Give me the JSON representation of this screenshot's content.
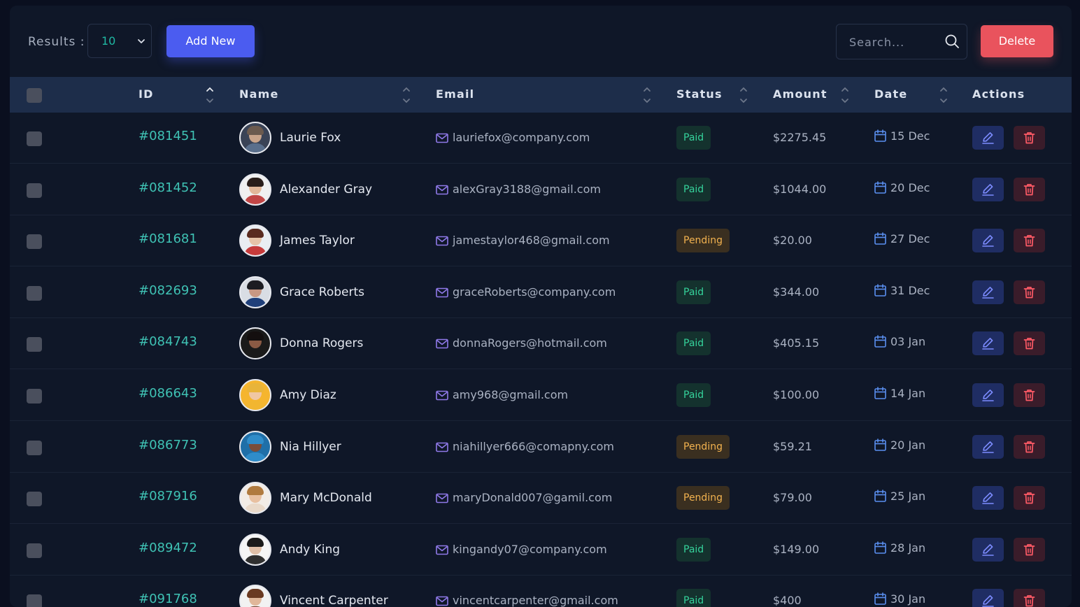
{
  "toolbar": {
    "results_label": "Results :",
    "results_value": "10",
    "add_label": "Add New",
    "search_placeholder": "Search...",
    "delete_label": "Delete"
  },
  "columns": {
    "id": "ID",
    "name": "Name",
    "email": "Email",
    "status": "Status",
    "amount": "Amount",
    "date": "Date",
    "actions": "Actions"
  },
  "rows": [
    {
      "id": "#081451",
      "name": "Laurie Fox",
      "email": "lauriefox@company.com",
      "status": "Paid",
      "amount": "$2275.45",
      "date": "15 Dec"
    },
    {
      "id": "#081452",
      "name": "Alexander Gray",
      "email": "alexGray3188@gmail.com",
      "status": "Paid",
      "amount": "$1044.00",
      "date": "20 Dec"
    },
    {
      "id": "#081681",
      "name": "James Taylor",
      "email": "jamestaylor468@gmail.com",
      "status": "Pending",
      "amount": "$20.00",
      "date": "27 Dec"
    },
    {
      "id": "#082693",
      "name": "Grace Roberts",
      "email": "graceRoberts@company.com",
      "status": "Paid",
      "amount": "$344.00",
      "date": "31 Dec"
    },
    {
      "id": "#084743",
      "name": "Donna Rogers",
      "email": "donnaRogers@hotmail.com",
      "status": "Paid",
      "amount": "$405.15",
      "date": "03 Jan"
    },
    {
      "id": "#086643",
      "name": "Amy Diaz",
      "email": "amy968@gmail.com",
      "status": "Paid",
      "amount": "$100.00",
      "date": "14 Jan"
    },
    {
      "id": "#086773",
      "name": "Nia Hillyer",
      "email": "niahillyer666@comapny.com",
      "status": "Pending",
      "amount": "$59.21",
      "date": "20 Jan"
    },
    {
      "id": "#087916",
      "name": "Mary McDonald",
      "email": "maryDonald007@gamil.com",
      "status": "Pending",
      "amount": "$79.00",
      "date": "25 Jan"
    },
    {
      "id": "#089472",
      "name": "Andy King",
      "email": "kingandy07@company.com",
      "status": "Paid",
      "amount": "$149.00",
      "date": "28 Jan"
    },
    {
      "id": "#091768",
      "name": "Vincent Carpenter",
      "email": "vincentcarpenter@gmail.com",
      "status": "Paid",
      "amount": "$400",
      "date": "30 Jan"
    }
  ],
  "avatars": [
    {
      "skin": "#c9a48a",
      "hair": "#6b5a4e",
      "shirt": "#5a6f8c",
      "bg": "#3a4356"
    },
    {
      "skin": "#e2b89a",
      "hair": "#2a1e1a",
      "shirt": "#c24646",
      "bg": "#f0f0f0"
    },
    {
      "skin": "#e6c3a8",
      "hair": "#5a2b20",
      "shirt": "#c73b3b",
      "bg": "#e9edf2"
    },
    {
      "skin": "#c99883",
      "hair": "#1c1c22",
      "shirt": "#1f3f7a",
      "bg": "#d9dde4"
    },
    {
      "skin": "#8a5a44",
      "hair": "#140f0f",
      "shirt": "#1a1a1a",
      "bg": "#1a1a1a"
    },
    {
      "skin": "#f0c7a4",
      "hair": "#e8b43a",
      "shirt": "#f2b630",
      "bg": "#f5b52e"
    },
    {
      "skin": "#7a4d3a",
      "hair": "#2f8cc9",
      "shirt": "#2f8cc9",
      "bg": "#1f6fa8"
    },
    {
      "skin": "#e8c0a0",
      "hair": "#b07a3e",
      "shirt": "#e9d9c9",
      "bg": "#f2ece6"
    },
    {
      "skin": "#e0c0a8",
      "hair": "#1a1a1a",
      "shirt": "#303030",
      "bg": "#f5f5f5"
    },
    {
      "skin": "#e0b79a",
      "hair": "#6a3a22",
      "shirt": "#6a3a22",
      "bg": "#f2f2f2"
    }
  ],
  "icons": {
    "chevron": "chevron-down-icon",
    "search": "search-icon",
    "sort": "sort-icon",
    "mail": "mail-icon",
    "calendar": "calendar-icon",
    "edit": "edit-icon",
    "trash": "trash-icon"
  },
  "colors": {
    "accent": "#4b5cf0",
    "danger": "#e9535d",
    "teal": "#1fb8a3",
    "paid": "#35d39b",
    "pending": "#f2b24f"
  }
}
